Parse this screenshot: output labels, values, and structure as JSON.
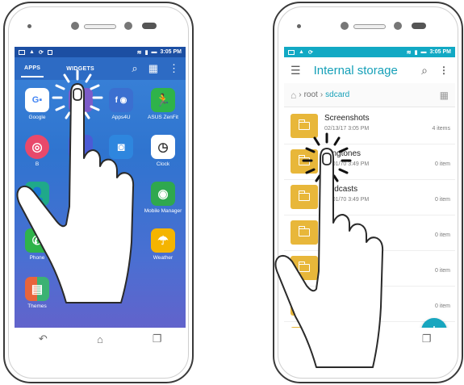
{
  "left_phone": {
    "status_bar": {
      "time": "3:05 PM"
    },
    "drawer_tabs": [
      {
        "label": "APPS",
        "active": true
      },
      {
        "label": "WIDGETS",
        "active": false
      }
    ],
    "apps": [
      {
        "label": "Google",
        "icon": "google-folder-icon",
        "color": "#ffffff"
      },
      {
        "label": "",
        "icon": "app-icon",
        "color": "#7c5cc9"
      },
      {
        "label": "Apps4U",
        "icon": "apps4u-folder-icon",
        "color": "#3b6fd0"
      },
      {
        "label": "ASUS ZenFit",
        "icon": "zenfit-icon",
        "color": "#2fb34a"
      },
      {
        "label": "B",
        "icon": "app-icon",
        "color": "#e8496b"
      },
      {
        "label": "C",
        "icon": "app-icon",
        "color": "#4b5bd6"
      },
      {
        "label": "",
        "icon": "camera-icon",
        "color": "#2e86de"
      },
      {
        "label": "Clock",
        "icon": "clock-icon",
        "color": "#ffffff"
      },
      {
        "label": "Contac",
        "icon": "contacts-icon",
        "color": "#1fa98a"
      },
      {
        "label": "Mobile Manager",
        "icon": "mobile-manager-icon",
        "color": "#2fa84f"
      },
      {
        "label": "Phone",
        "icon": "phone-icon",
        "color": "#2fb34a"
      },
      {
        "label": "Weather",
        "icon": "weather-icon",
        "color": "#f4b400"
      },
      {
        "label": "Themes",
        "icon": "themes-icon",
        "color": "#e8643c"
      }
    ]
  },
  "right_phone": {
    "status_bar": {
      "time": "3:05 PM"
    },
    "header": {
      "title": "Internal storage"
    },
    "breadcrumb": {
      "root": "root",
      "current": "sdcard"
    },
    "files": [
      {
        "name": "Screenshots",
        "date": "02/13/17 3:05 PM",
        "count": "4 items"
      },
      {
        "name": "Ringtones",
        "date": "01/01/70 3:49 PM",
        "count": "0 item"
      },
      {
        "name": "Podcasts",
        "date": "01/01/70 3:49 PM",
        "count": "0 item"
      },
      {
        "name": "",
        "date": "",
        "count": "0 item"
      },
      {
        "name": "",
        "date": "",
        "count": "0 item"
      },
      {
        "name": "",
        "date": "",
        "count": "0 item"
      },
      {
        "name": "",
        "date": "",
        "count": "item"
      }
    ],
    "fab": {
      "label": "+"
    }
  }
}
